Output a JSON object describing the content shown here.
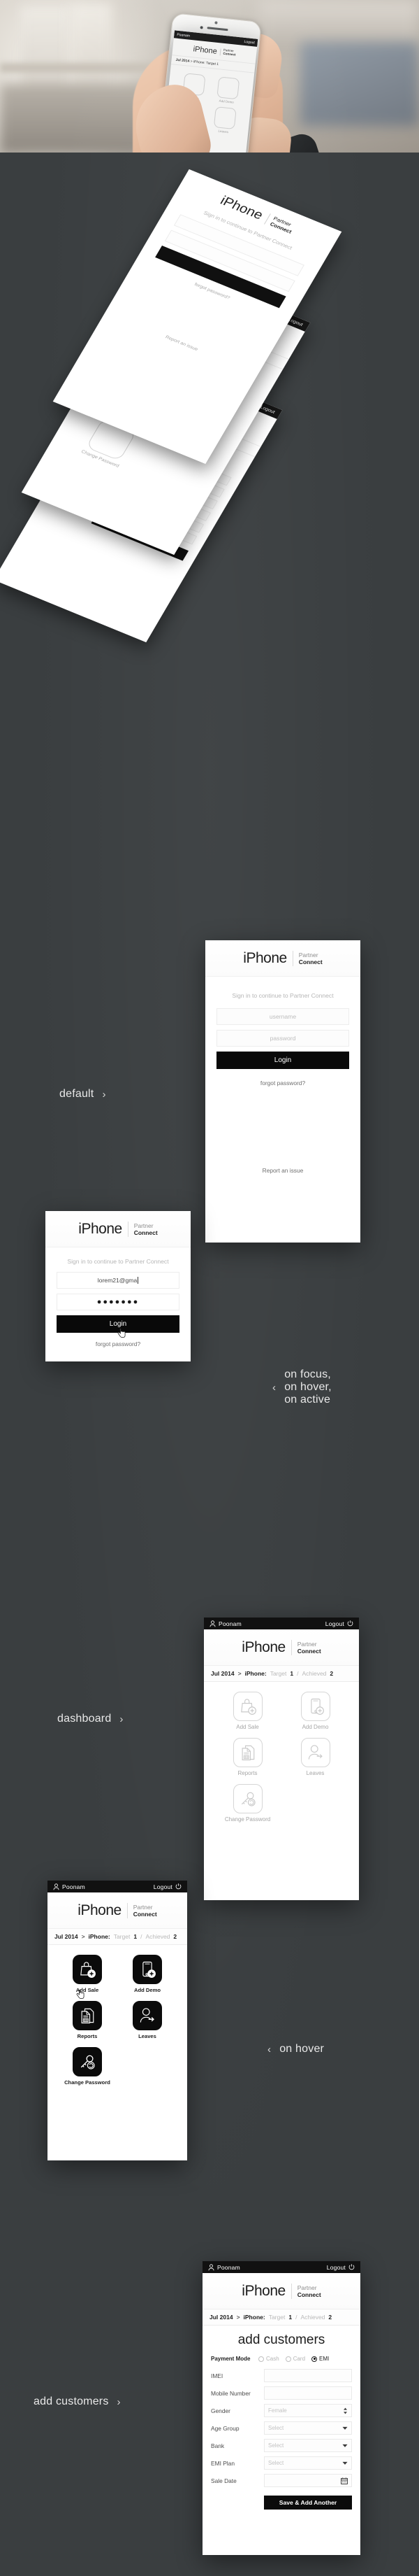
{
  "brand": {
    "iphone": "iPhone",
    "partner": "Partner",
    "connect": "Connect"
  },
  "statusbar": {
    "user": "Poonam",
    "logout": "Logout",
    "user_icon": "person-icon",
    "power_icon": "power-icon"
  },
  "breadcrumb": {
    "month": "Jul 2014",
    "separator": ">",
    "device": "iPhone:",
    "target_label": "Target",
    "target_value": "1",
    "slash": "/",
    "achieved_label": "Achieved",
    "achieved_value": "2"
  },
  "login": {
    "subtitle": "Sign in to continue to Partner Connect",
    "username_placeholder": "username",
    "password_placeholder": "password",
    "username_value": "lorem21@gma",
    "password_value": "●●●●●●●",
    "login_label": "Login",
    "forgot_label": "forgot password?",
    "report_label": "Report an issue"
  },
  "dashboard": {
    "tiles": [
      {
        "label": "Add Sale",
        "icon": "shopping-bag-plus-icon"
      },
      {
        "label": "Add Demo",
        "icon": "phone-plus-icon"
      },
      {
        "label": "Reports",
        "icon": "documents-icon"
      },
      {
        "label": "Leaves",
        "icon": "person-arrow-icon"
      },
      {
        "label": "Change Password",
        "icon": "key-refresh-icon"
      }
    ]
  },
  "add_customers": {
    "title": "add customers",
    "payment_mode_label": "Payment Mode",
    "payment_options": [
      {
        "label": "Cash",
        "selected": false
      },
      {
        "label": "Card",
        "selected": false
      },
      {
        "label": "EMI",
        "selected": true
      }
    ],
    "fields": [
      {
        "label": "IMEI",
        "value": "",
        "control": "text"
      },
      {
        "label": "Mobile Number",
        "value": "",
        "control": "text"
      },
      {
        "label": "Gender",
        "value": "Female",
        "control": "stepper"
      },
      {
        "label": "Age Group",
        "value": "Select",
        "control": "select"
      },
      {
        "label": "Bank",
        "value": "Select",
        "control": "select"
      },
      {
        "label": "EMI Plan",
        "value": "Select",
        "control": "select"
      },
      {
        "label": "Sale Date",
        "value": "",
        "control": "date"
      }
    ],
    "save_label": "Save & Add Another"
  },
  "captions": {
    "default": "default",
    "states_line1": "on focus,",
    "states_line2": "on hover,",
    "states_line3": "on active",
    "dashboard": "dashboard",
    "on_hover": "on hover",
    "add_customers": "add customers",
    "chevron_right": "›",
    "chevron_left": "‹"
  },
  "colors": {
    "background": "#3a3e40",
    "accent": "#0b0b0b",
    "screen": "#ffffff",
    "caption": "#e9e9e9"
  }
}
